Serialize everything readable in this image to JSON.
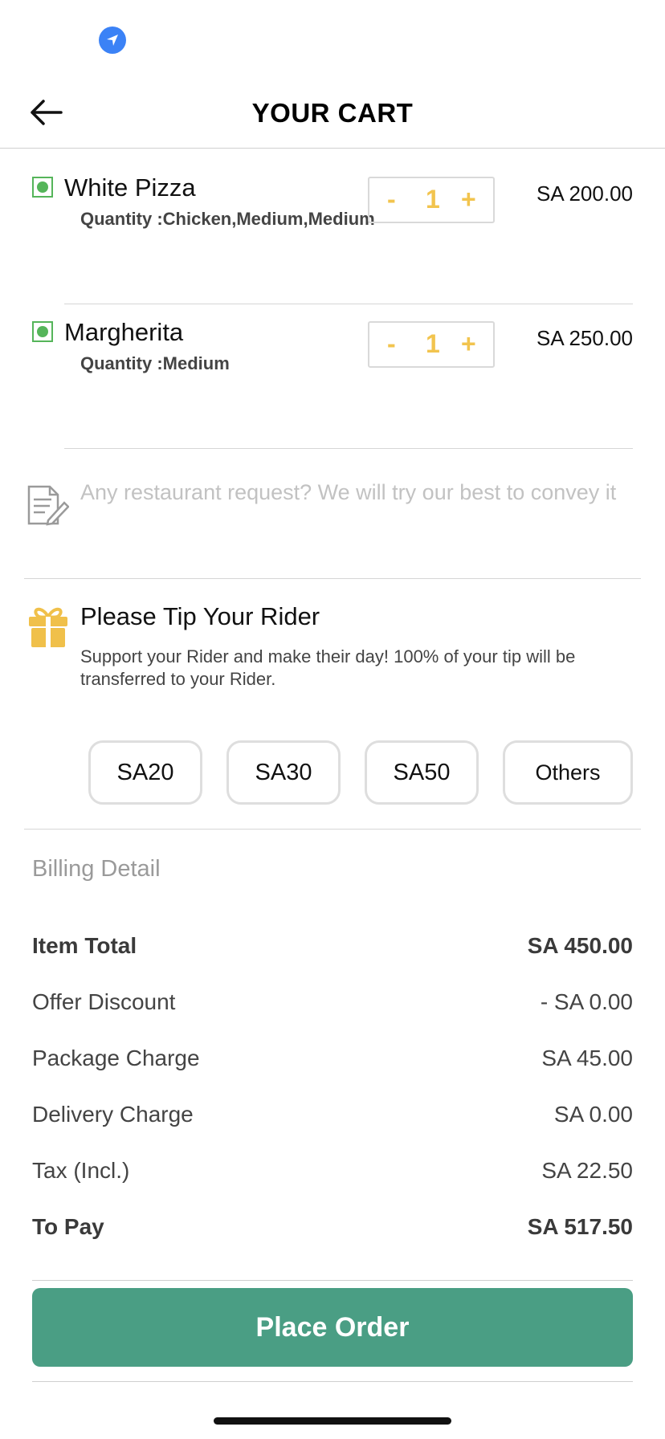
{
  "header": {
    "title": "YOUR CART"
  },
  "items": [
    {
      "name": "White Pizza",
      "sub": "Quantity :Chicken,Medium,Medium",
      "minus": "-",
      "qty": "1",
      "plus": "+",
      "price": "SA 200.00"
    },
    {
      "name": "Margherita",
      "sub": "Quantity :Medium",
      "minus": "-",
      "qty": "1",
      "plus": "+",
      "price": "SA 250.00"
    }
  ],
  "request": {
    "placeholder": "Any restaurant request? We will try our best to convey it"
  },
  "tip": {
    "title": "Please Tip Your Rider",
    "description": "Support your Rider and make their day! 100% of your tip will be transferred to your Rider.",
    "options": [
      "SA20",
      "SA30",
      "SA50",
      "Others"
    ]
  },
  "billing": {
    "heading": "Billing Detail",
    "rows": [
      {
        "label": "Item Total",
        "value": "SA 450.00"
      },
      {
        "label": "Offer Discount",
        "value": "- SA 0.00"
      },
      {
        "label": "Package Charge",
        "value": "SA 45.00"
      },
      {
        "label": "Delivery Charge",
        "value": "SA 0.00"
      },
      {
        "label": "Tax (Incl.)",
        "value": "SA 22.50"
      },
      {
        "label": "To Pay",
        "value": "SA 517.50"
      }
    ]
  },
  "actions": {
    "place_order": "Place Order"
  },
  "colors": {
    "accent": "#4a9e84",
    "qty": "#f2c44e",
    "veg": "#55b55a",
    "gift": "#f0c04a",
    "location": "#3b82f6"
  },
  "icons": {
    "status": "location-arrow-icon",
    "back": "back-arrow-icon",
    "note": "note-pencil-icon",
    "gift": "gift-icon"
  }
}
